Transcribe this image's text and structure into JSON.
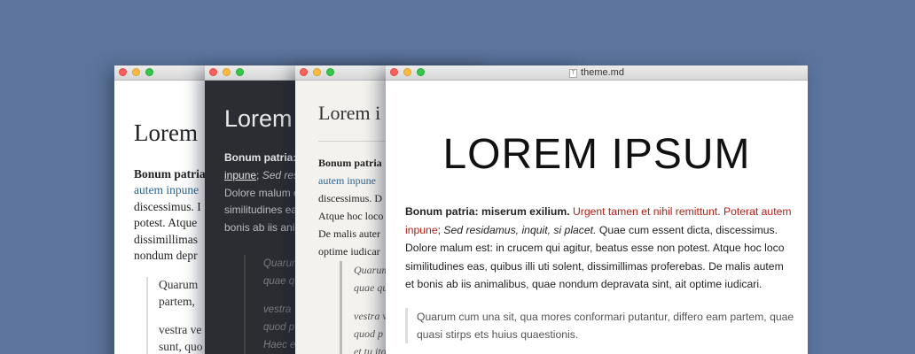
{
  "windows": [
    {
      "id": "serif-light",
      "heading": "Lorem",
      "para": {
        "bold": "Bonum patria",
        "line1_rest": "",
        "blue": "autem inpune",
        "lines": [
          "discessimus. I",
          "potest. Atque",
          "dissimillimas",
          "nondum depr"
        ]
      },
      "quote": [
        "Quarum",
        "partem,",
        "vestra ve",
        "sunt, quo"
      ]
    },
    {
      "id": "dark",
      "heading": "Lorem",
      "para": {
        "bold": "Bonum patria:",
        "link": "inpune",
        "after_link": ";",
        "italic": "Sed res",
        "lines": [
          "Dolore malum e",
          "similitudines ea",
          "bonis ab iis ani"
        ]
      },
      "quote": [
        "Quarum",
        "quae q",
        "vestra",
        "quod p",
        "Haec e"
      ]
    },
    {
      "id": "cream",
      "heading": "Lorem i",
      "para": {
        "bold": "Bonum patria",
        "blue": "autem inpune",
        "lines": [
          "discessimus. D",
          "Atque hoc loco",
          "De malis auter",
          "optime iudicar"
        ]
      },
      "quote": [
        "Quarum",
        "quae qu",
        "vestra v",
        "quod p",
        "et tu ito"
      ]
    },
    {
      "id": "front",
      "filename": "theme.md",
      "file_icon": "T",
      "heading": "LOREM IPSUM",
      "para": {
        "bold": "Bonum patria: miserum exilium.",
        "red1": "Urgent tamen et nihil remittunt. Poterat autem inpune",
        "semi": ";",
        "italic": "Sed residamus, inquit, si placet.",
        "rest": "Quae cum essent dicta, discessimus. Dolore malum est: in crucem qui agitur, beatus esse non potest. Atque hoc loco similitudines eas, quibus illi uti solent, dissimillimas proferebas. De malis autem et bonis ab iis animalibus, quae nondum depravata sint, ait optime iudicari."
      },
      "quote": "Quarum cum una sit, qua mores conformari putantur, differo eam partem, quae quasi stirps ets huius quaestionis."
    }
  ]
}
